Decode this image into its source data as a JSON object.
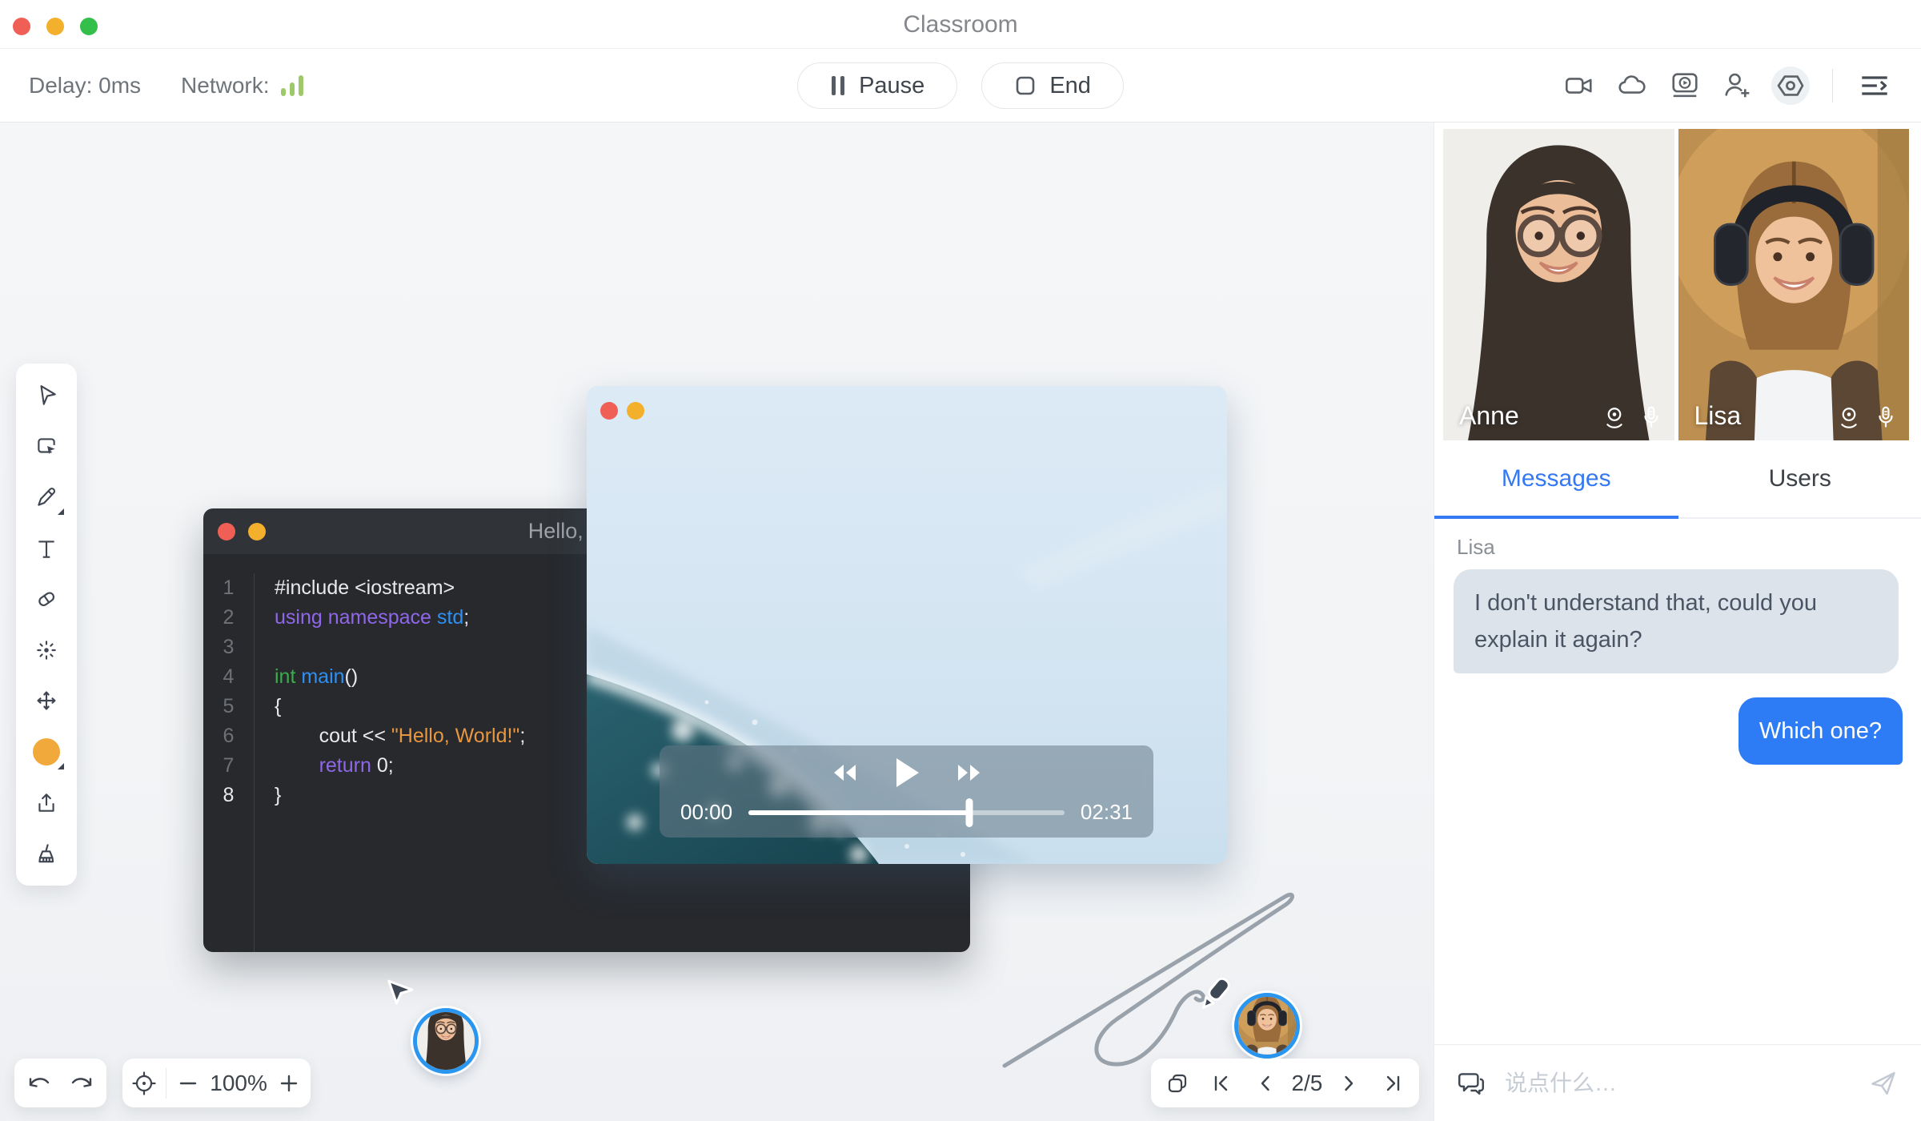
{
  "window": {
    "title": "Classroom"
  },
  "toolbar": {
    "delay_label": "Delay: 0ms",
    "network_label": "Network:",
    "pause_label": "Pause",
    "end_label": "End"
  },
  "whiteboard": {
    "zoom_level": "100%",
    "page_indicator": "2/5",
    "pen_color": "#f2a93b",
    "code_window": {
      "title": "Hello, World",
      "lines": [
        {
          "num": "1",
          "tokens": [
            {
              "t": "#include <iostream>",
              "c": "plain"
            }
          ]
        },
        {
          "num": "2",
          "tokens": [
            {
              "t": "using namespace",
              "c": "keyword"
            },
            {
              "t": " ",
              "c": "plain"
            },
            {
              "t": "std",
              "c": "type"
            },
            {
              "t": ";",
              "c": "plain"
            }
          ]
        },
        {
          "num": "3",
          "tokens": []
        },
        {
          "num": "4",
          "tokens": [
            {
              "t": "int",
              "c": "green"
            },
            {
              "t": " ",
              "c": "plain"
            },
            {
              "t": "main",
              "c": "type"
            },
            {
              "t": "()",
              "c": "plain"
            }
          ]
        },
        {
          "num": "5",
          "tokens": [
            {
              "t": "{",
              "c": "plain"
            }
          ]
        },
        {
          "num": "6",
          "tokens": [
            {
              "t": "        cout << ",
              "c": "plain"
            },
            {
              "t": "\"Hello, World!\"",
              "c": "string"
            },
            {
              "t": ";",
              "c": "plain"
            }
          ]
        },
        {
          "num": "7",
          "tokens": [
            {
              "t": "        ",
              "c": "plain"
            },
            {
              "t": "return",
              "c": "keyword"
            },
            {
              "t": " 0;",
              "c": "plain"
            }
          ]
        },
        {
          "num": "8",
          "tokens": [
            {
              "t": "}",
              "c": "plain"
            }
          ],
          "active": true
        }
      ]
    },
    "video_player": {
      "current_time": "00:00",
      "duration": "02:31",
      "progress": 0.7
    }
  },
  "participants": [
    {
      "name": "Anne"
    },
    {
      "name": "Lisa"
    }
  ],
  "chat": {
    "tabs": [
      {
        "label": "Messages",
        "active": true
      },
      {
        "label": "Users",
        "active": false
      }
    ],
    "messages": [
      {
        "sender": "Lisa",
        "text": "I don't understand that, could you explain it again?",
        "direction": "received"
      },
      {
        "text": "Which one?",
        "direction": "sent"
      }
    ],
    "input_placeholder": "说点什么…"
  },
  "colors": {
    "accent_blue": "#3478f2",
    "bubble_sent": "#2e7cf5",
    "bubble_received": "#dce3eb",
    "network_green": "#9ec96a",
    "traffic_red": "#ef5f56",
    "traffic_yellow": "#f2b02c",
    "traffic_green": "#33bf49"
  }
}
